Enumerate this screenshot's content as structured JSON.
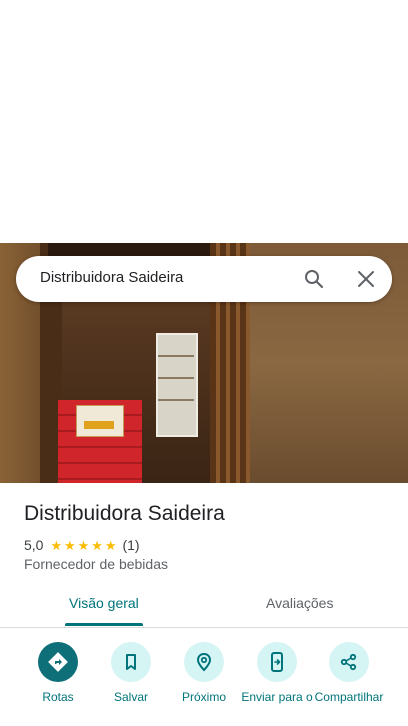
{
  "search": {
    "query": "Distribuidora Saideira"
  },
  "place": {
    "name": "Distribuidora Saideira",
    "rating": "5,0",
    "stars": 5,
    "review_count": "(1)",
    "category": "Fornecedor de bebidas"
  },
  "tabs": [
    {
      "label": "Visão geral",
      "active": true
    },
    {
      "label": "Avaliações",
      "active": false
    }
  ],
  "actions": [
    {
      "label": "Rotas",
      "icon": "directions-icon"
    },
    {
      "label": "Salvar",
      "icon": "bookmark-icon"
    },
    {
      "label": "Próximo",
      "icon": "nearby-icon"
    },
    {
      "label": "Enviar para o",
      "icon": "send-to-phone-icon"
    },
    {
      "label": "Compartilhar",
      "icon": "share-icon"
    }
  ],
  "colors": {
    "accent": "#00747a",
    "primary_button": "#0e6f79",
    "action_bg": "#d5f4f4",
    "star": "#fbbc04"
  }
}
